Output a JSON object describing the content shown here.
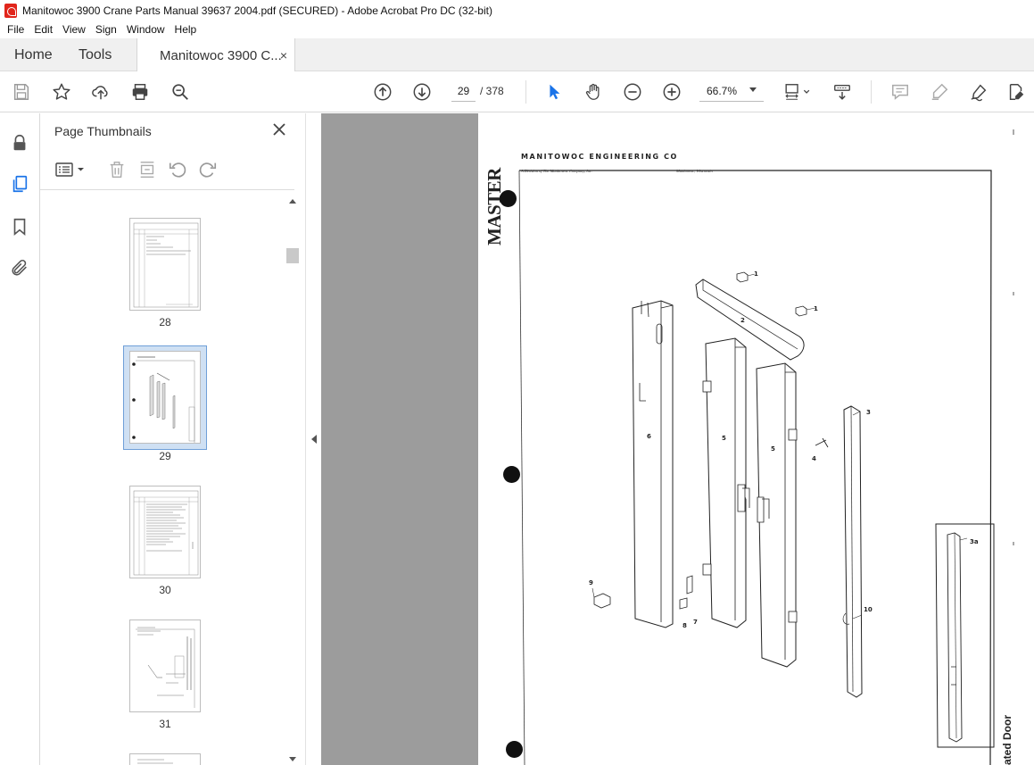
{
  "window": {
    "title": "Manitowoc 3900 Crane Parts Manual 39637 2004.pdf (SECURED) - Adobe Acrobat Pro DC (32-bit)"
  },
  "menu": [
    "File",
    "Edit",
    "View",
    "Sign",
    "Window",
    "Help"
  ],
  "tabs": {
    "home": "Home",
    "tools": "Tools",
    "document": "Manitowoc 3900 C...",
    "close_glyph": "×"
  },
  "toolbar": {
    "current_page": "29",
    "total_pages": "/ 378",
    "zoom": "66.7%"
  },
  "thumbnails_panel": {
    "title": "Page Thumbnails",
    "pages": [
      {
        "label": "28",
        "selected": false
      },
      {
        "label": "29",
        "selected": true
      },
      {
        "label": "30",
        "selected": false
      },
      {
        "label": "31",
        "selected": false
      }
    ]
  },
  "document": {
    "header": "MANITOWOC ENGINEERING CO",
    "sub_left": "A Division of The Manitowoc Company, Inc.",
    "sub_right": "Manitowoc, Wisconsin",
    "master_stamp": "MASTER",
    "vertical_label": "ated Door",
    "callouts": [
      "1",
      "1",
      "2",
      "3",
      "3a",
      "4",
      "5",
      "5",
      "6",
      "7",
      "8",
      "9",
      "10"
    ]
  },
  "colors": {
    "accent_blue": "#1a73e8",
    "selection_blue": "#cfe0f3",
    "doc_background": "#9c9c9c",
    "acrobat_red": "#e1251b"
  }
}
